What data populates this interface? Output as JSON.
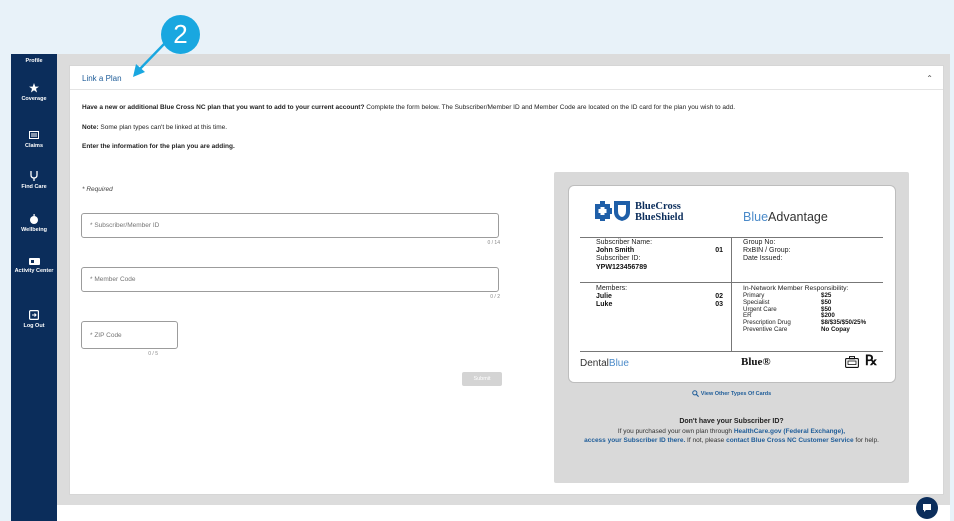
{
  "callout": {
    "number": "2"
  },
  "sidebar": {
    "items": [
      {
        "label": "Profile",
        "icon": "profile-icon"
      },
      {
        "label": "Coverage",
        "icon": "star-icon"
      },
      {
        "label": "Claims",
        "icon": "claims-icon"
      },
      {
        "label": "Find Care",
        "icon": "find-care-icon"
      },
      {
        "label": "Wellbeing",
        "icon": "apple-icon"
      },
      {
        "label": "Activity Center",
        "icon": "activity-icon"
      },
      {
        "label": "Log Out",
        "icon": "logout-icon"
      }
    ]
  },
  "link_plan": {
    "title": "Link a Plan",
    "intro": "Have a new or additional Blue Cross NC plan that you want to add to your current account?",
    "intro_rest": "Complete the form below. The Subscriber/Member ID and Member Code are located on the ID card for the plan you wish to add.",
    "note_label": "Note:",
    "note_text": "Some plan types can't be linked at this time.",
    "enter_info": "Enter the information for the plan you are adding.",
    "required": "* Required",
    "subscriber_placeholder": "* Subscriber/Member ID",
    "subscriber_counter": "0 / 14",
    "member_code_placeholder": "* Member Code",
    "member_code_counter": "0 / 2",
    "zip_placeholder": "* ZIP Code",
    "zip_counter": "0 / 5",
    "submit_label": "Submit"
  },
  "id_card": {
    "brand_line1": "BlueCross",
    "brand_line2": "BlueShield",
    "plan_blue": "Blue",
    "plan_rest": "Advantage",
    "subscriber_name_label": "Subscriber Name:",
    "subscriber_name": "John Smith",
    "subscriber_suffix": "01",
    "subscriber_id_label": "Subscriber ID:",
    "subscriber_id": "YPW123456789",
    "members_label": "Members:",
    "members": [
      {
        "name": "Julie",
        "code": "02"
      },
      {
        "name": "Luke",
        "code": "03"
      }
    ],
    "group_no": "Group No:",
    "rxbin": "RxBIN / Group:",
    "date_issued": "Date Issued:",
    "resp_title": "In-Network Member Responsibility:",
    "resp": [
      {
        "label": "Primary",
        "value": "$25"
      },
      {
        "label": "Specialist",
        "value": "$50"
      },
      {
        "label": "Urgent Care",
        "value": "$50"
      },
      {
        "label": "ER",
        "value": "$200"
      },
      {
        "label": "Prescription Drug",
        "value": "$8/$35/$50/25%"
      },
      {
        "label": "Preventive Care",
        "value": "No Copay"
      }
    ],
    "dental_prefix": "Dental",
    "dental_blue": "Blue",
    "blue_mark": "Blue®",
    "rx_mark": "℞"
  },
  "help": {
    "view_other": "View Other Types Of Cards",
    "question": "Don't have your Subscriber ID?",
    "line1_a": "If you purchased your own plan through ",
    "link1": "HealthCare.gov (Federal Exchange),",
    "link2": "access your Subscriber ID there.",
    "line2_b": " If not, please ",
    "link3": "contact Blue Cross NC Customer Service",
    "line3_c": " for help."
  }
}
